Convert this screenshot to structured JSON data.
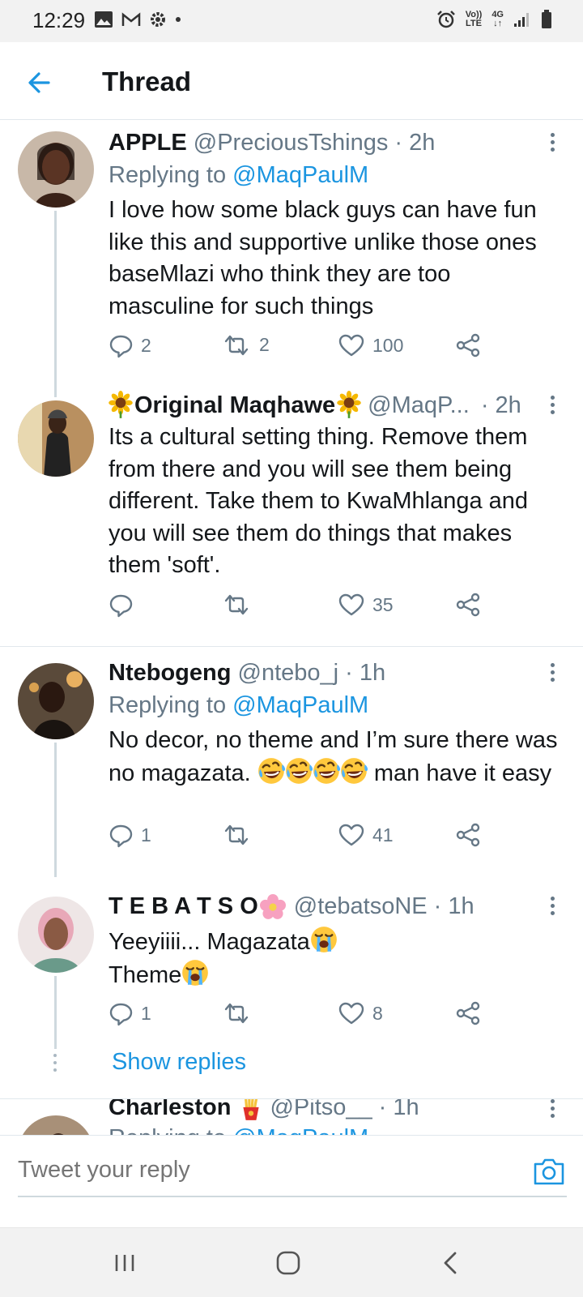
{
  "status_bar": {
    "time": "12:29",
    "network_top": "Vo))",
    "network_bottom": "LTE",
    "gen_top": "4G",
    "gen_bottom": "↓↑"
  },
  "header": {
    "title": "Thread"
  },
  "tweets": [
    {
      "name": "APPLE",
      "handle": "@PreciousTshings",
      "time": "· 2h",
      "replying_prefix": "Replying to ",
      "replying_to": "@MaqPaulM",
      "body": "I love how some black guys can have fun like this and supportive unlike those ones baseMlazi who think they are too masculine for such things",
      "replies": "2",
      "retweets": "2",
      "likes": "100"
    },
    {
      "name": "Original Maqhawe",
      "handle": "@MaqP...",
      "time": "· 2h",
      "body": "Its a cultural setting thing. Remove them from there and you will see them being different. Take them to KwaMhlanga and you will see them do things that makes them 'soft'.",
      "replies": "",
      "retweets": "",
      "likes": "35"
    },
    {
      "name": "Ntebogeng",
      "handle": "@ntebo_j",
      "time": "· 1h",
      "replying_prefix": "Replying to ",
      "replying_to": "@MaqPaulM",
      "body_part1": "No decor, no theme and I’m sure there was no magazata. ",
      "body_part2": " man have it easy",
      "replies": "1",
      "retweets": "",
      "likes": "41"
    },
    {
      "name": "T E B A T S O",
      "handle": "@tebatsoNE",
      "time": "· 1h",
      "body_line1": "Yeeyiiii... Magazata",
      "body_line2": "Theme",
      "replies": "1",
      "retweets": "",
      "likes": "8",
      "show_replies": "Show replies"
    },
    {
      "name": "Charleston",
      "handle": "@Pitso__",
      "time": "· 1h",
      "replying_prefix": "Replying to ",
      "replying_to": "@MaqPaulM"
    }
  ],
  "reply_bar": {
    "placeholder": "Tweet your reply"
  },
  "icons": {
    "back": "arrow-left-icon",
    "more": "more-vertical-icon",
    "reply": "comment-icon",
    "retweet": "retweet-icon",
    "like": "heart-icon",
    "share": "share-icon",
    "camera": "camera-icon"
  },
  "colors": {
    "accent": "#1b95e0",
    "text": "#14171a",
    "secondary": "#657786",
    "border": "#e1e8ed"
  }
}
